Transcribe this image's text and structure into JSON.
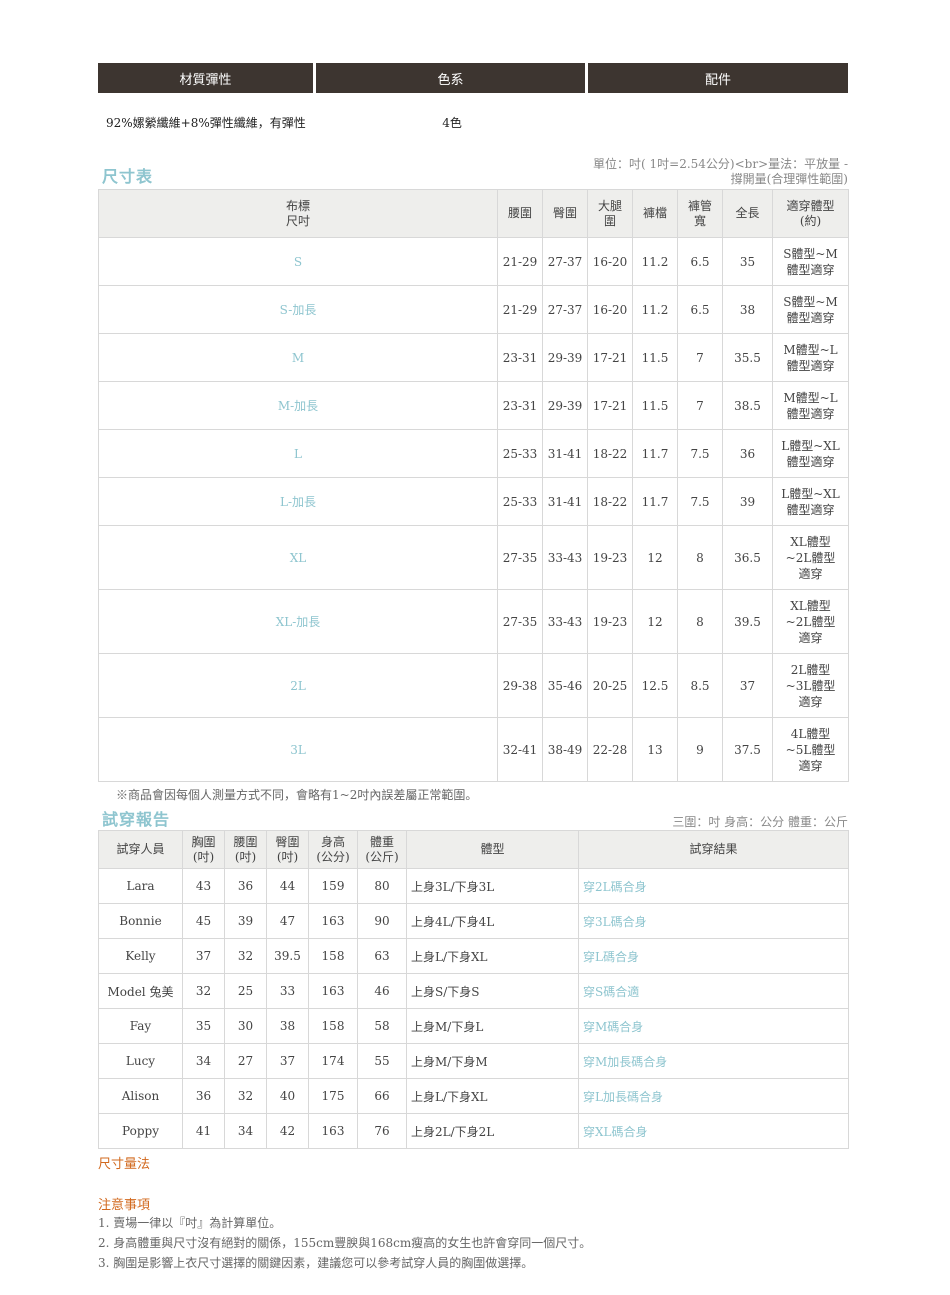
{
  "material": {
    "headers": [
      "材質彈性",
      "色系",
      "配件"
    ],
    "values": [
      "92%嫘縈纖維+8%彈性纖維，有彈性",
      "4色",
      ""
    ]
  },
  "size_chart": {
    "title": "尺寸表",
    "note": "單位：吋( 1吋=2.54公分)<br>量法：平放量 - 撐開量(合理彈性範圍)",
    "headers": [
      "布標\n尺吋",
      "腰圍",
      "臀圍",
      "大腿\n圍",
      "褲檔",
      "褲管\n寬",
      "全長",
      "適穿體型\n(約)"
    ],
    "rows": [
      [
        "S",
        "21-29",
        "27-37",
        "16-20",
        "11.2",
        "6.5",
        "35",
        "S體型~M\n體型適穿"
      ],
      [
        "S-加長",
        "21-29",
        "27-37",
        "16-20",
        "11.2",
        "6.5",
        "38",
        "S體型~M\n體型適穿"
      ],
      [
        "M",
        "23-31",
        "29-39",
        "17-21",
        "11.5",
        "7",
        "35.5",
        "M體型~L\n體型適穿"
      ],
      [
        "M-加長",
        "23-31",
        "29-39",
        "17-21",
        "11.5",
        "7",
        "38.5",
        "M體型~L\n體型適穿"
      ],
      [
        "L",
        "25-33",
        "31-41",
        "18-22",
        "11.7",
        "7.5",
        "36",
        "L體型~XL\n體型適穿"
      ],
      [
        "L-加長",
        "25-33",
        "31-41",
        "18-22",
        "11.7",
        "7.5",
        "39",
        "L體型~XL\n體型適穿"
      ],
      [
        "XL",
        "27-35",
        "33-43",
        "19-23",
        "12",
        "8",
        "36.5",
        "XL體型\n~2L體型\n適穿"
      ],
      [
        "XL-加長",
        "27-35",
        "33-43",
        "19-23",
        "12",
        "8",
        "39.5",
        "XL體型\n~2L體型\n適穿"
      ],
      [
        "2L",
        "29-38",
        "35-46",
        "20-25",
        "12.5",
        "8.5",
        "37",
        "2L體型\n~3L體型\n適穿"
      ],
      [
        "3L",
        "32-41",
        "38-49",
        "22-28",
        "13",
        "9",
        "37.5",
        "4L體型\n~5L體型\n適穿"
      ]
    ],
    "remark": "※商品會因每個人測量方式不同，會略有1~2吋內誤差屬正常範圍。"
  },
  "try_on": {
    "title": "試穿報告",
    "note": "三圍：吋 身高：公分 體重：公斤",
    "headers": [
      "試穿人員",
      "胸圍\n(吋)",
      "腰圍\n(吋)",
      "臀圍\n(吋)",
      "身高\n(公分)",
      "體重\n(公斤)",
      "體型",
      "試穿結果"
    ],
    "rows": [
      [
        "Lara",
        "43",
        "36",
        "44",
        "159",
        "80",
        "上身3L/下身3L",
        "穿2L碼合身"
      ],
      [
        "Bonnie",
        "45",
        "39",
        "47",
        "163",
        "90",
        "上身4L/下身4L",
        "穿3L碼合身"
      ],
      [
        "Kelly",
        "37",
        "32",
        "39.5",
        "158",
        "63",
        "上身L/下身XL",
        "穿L碼合身"
      ],
      [
        "Model 兔美",
        "32",
        "25",
        "33",
        "163",
        "46",
        "上身S/下身S",
        "穿S碼合適"
      ],
      [
        "Fay",
        "35",
        "30",
        "38",
        "158",
        "58",
        "上身M/下身L",
        "穿M碼合身"
      ],
      [
        "Lucy",
        "34",
        "27",
        "37",
        "174",
        "55",
        "上身M/下身M",
        "穿M加長碼合身"
      ],
      [
        "Alison",
        "36",
        "32",
        "40",
        "175",
        "66",
        "上身L/下身XL",
        "穿L加長碼合身"
      ],
      [
        "Poppy",
        "41",
        "34",
        "42",
        "163",
        "76",
        "上身2L/下身2L",
        "穿XL碼合身"
      ]
    ]
  },
  "measure_title": "尺寸量法",
  "notes": {
    "title": "注意事項",
    "items": [
      "1. 賣場一律以『吋』為計算單位。",
      "2. 身高體重與尺寸沒有絕對的關係，155cm豐腴與168cm瘦高的女生也許會穿同一個尺寸。",
      "3. 胸圍是影響上衣尺寸選擇的關鍵因素，建議您可以參考試穿人員的胸圍做選擇。"
    ]
  }
}
